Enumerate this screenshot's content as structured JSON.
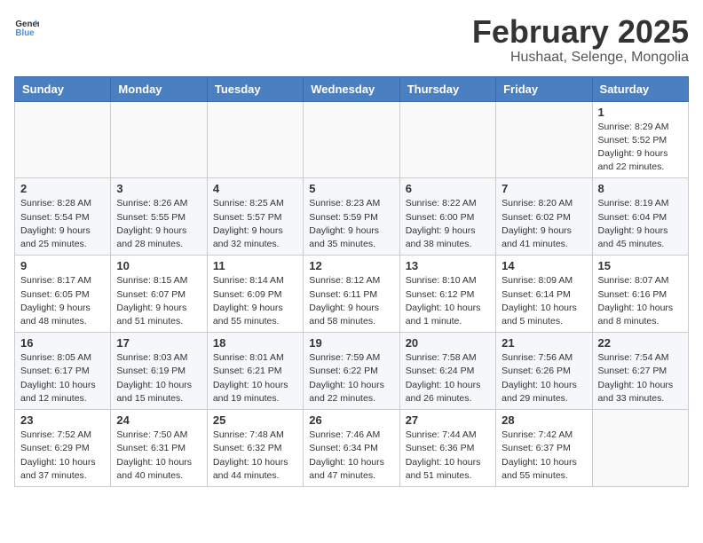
{
  "header": {
    "logo_general": "General",
    "logo_blue": "Blue",
    "month_title": "February 2025",
    "location": "Hushaat, Selenge, Mongolia"
  },
  "weekdays": [
    "Sunday",
    "Monday",
    "Tuesday",
    "Wednesday",
    "Thursday",
    "Friday",
    "Saturday"
  ],
  "weeks": [
    [
      {
        "day": "",
        "info": ""
      },
      {
        "day": "",
        "info": ""
      },
      {
        "day": "",
        "info": ""
      },
      {
        "day": "",
        "info": ""
      },
      {
        "day": "",
        "info": ""
      },
      {
        "day": "",
        "info": ""
      },
      {
        "day": "1",
        "info": "Sunrise: 8:29 AM\nSunset: 5:52 PM\nDaylight: 9 hours\nand 22 minutes."
      }
    ],
    [
      {
        "day": "2",
        "info": "Sunrise: 8:28 AM\nSunset: 5:54 PM\nDaylight: 9 hours\nand 25 minutes."
      },
      {
        "day": "3",
        "info": "Sunrise: 8:26 AM\nSunset: 5:55 PM\nDaylight: 9 hours\nand 28 minutes."
      },
      {
        "day": "4",
        "info": "Sunrise: 8:25 AM\nSunset: 5:57 PM\nDaylight: 9 hours\nand 32 minutes."
      },
      {
        "day": "5",
        "info": "Sunrise: 8:23 AM\nSunset: 5:59 PM\nDaylight: 9 hours\nand 35 minutes."
      },
      {
        "day": "6",
        "info": "Sunrise: 8:22 AM\nSunset: 6:00 PM\nDaylight: 9 hours\nand 38 minutes."
      },
      {
        "day": "7",
        "info": "Sunrise: 8:20 AM\nSunset: 6:02 PM\nDaylight: 9 hours\nand 41 minutes."
      },
      {
        "day": "8",
        "info": "Sunrise: 8:19 AM\nSunset: 6:04 PM\nDaylight: 9 hours\nand 45 minutes."
      }
    ],
    [
      {
        "day": "9",
        "info": "Sunrise: 8:17 AM\nSunset: 6:05 PM\nDaylight: 9 hours\nand 48 minutes."
      },
      {
        "day": "10",
        "info": "Sunrise: 8:15 AM\nSunset: 6:07 PM\nDaylight: 9 hours\nand 51 minutes."
      },
      {
        "day": "11",
        "info": "Sunrise: 8:14 AM\nSunset: 6:09 PM\nDaylight: 9 hours\nand 55 minutes."
      },
      {
        "day": "12",
        "info": "Sunrise: 8:12 AM\nSunset: 6:11 PM\nDaylight: 9 hours\nand 58 minutes."
      },
      {
        "day": "13",
        "info": "Sunrise: 8:10 AM\nSunset: 6:12 PM\nDaylight: 10 hours\nand 1 minute."
      },
      {
        "day": "14",
        "info": "Sunrise: 8:09 AM\nSunset: 6:14 PM\nDaylight: 10 hours\nand 5 minutes."
      },
      {
        "day": "15",
        "info": "Sunrise: 8:07 AM\nSunset: 6:16 PM\nDaylight: 10 hours\nand 8 minutes."
      }
    ],
    [
      {
        "day": "16",
        "info": "Sunrise: 8:05 AM\nSunset: 6:17 PM\nDaylight: 10 hours\nand 12 minutes."
      },
      {
        "day": "17",
        "info": "Sunrise: 8:03 AM\nSunset: 6:19 PM\nDaylight: 10 hours\nand 15 minutes."
      },
      {
        "day": "18",
        "info": "Sunrise: 8:01 AM\nSunset: 6:21 PM\nDaylight: 10 hours\nand 19 minutes."
      },
      {
        "day": "19",
        "info": "Sunrise: 7:59 AM\nSunset: 6:22 PM\nDaylight: 10 hours\nand 22 minutes."
      },
      {
        "day": "20",
        "info": "Sunrise: 7:58 AM\nSunset: 6:24 PM\nDaylight: 10 hours\nand 26 minutes."
      },
      {
        "day": "21",
        "info": "Sunrise: 7:56 AM\nSunset: 6:26 PM\nDaylight: 10 hours\nand 29 minutes."
      },
      {
        "day": "22",
        "info": "Sunrise: 7:54 AM\nSunset: 6:27 PM\nDaylight: 10 hours\nand 33 minutes."
      }
    ],
    [
      {
        "day": "23",
        "info": "Sunrise: 7:52 AM\nSunset: 6:29 PM\nDaylight: 10 hours\nand 37 minutes."
      },
      {
        "day": "24",
        "info": "Sunrise: 7:50 AM\nSunset: 6:31 PM\nDaylight: 10 hours\nand 40 minutes."
      },
      {
        "day": "25",
        "info": "Sunrise: 7:48 AM\nSunset: 6:32 PM\nDaylight: 10 hours\nand 44 minutes."
      },
      {
        "day": "26",
        "info": "Sunrise: 7:46 AM\nSunset: 6:34 PM\nDaylight: 10 hours\nand 47 minutes."
      },
      {
        "day": "27",
        "info": "Sunrise: 7:44 AM\nSunset: 6:36 PM\nDaylight: 10 hours\nand 51 minutes."
      },
      {
        "day": "28",
        "info": "Sunrise: 7:42 AM\nSunset: 6:37 PM\nDaylight: 10 hours\nand 55 minutes."
      },
      {
        "day": "",
        "info": ""
      }
    ]
  ]
}
